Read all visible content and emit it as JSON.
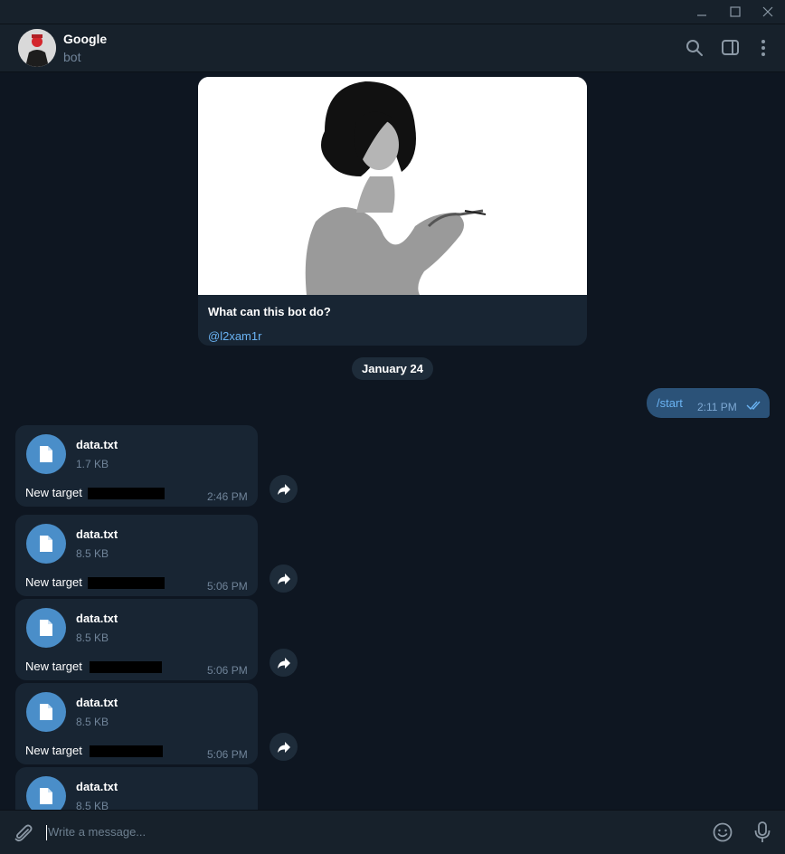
{
  "window": {
    "controls": [
      "minimize-icon",
      "maximize-icon",
      "close-icon"
    ]
  },
  "header": {
    "title": "Google",
    "subtitle": "bot",
    "actions": [
      "search-icon",
      "sidebar-toggle-icon",
      "more-vertical-icon"
    ]
  },
  "bot_intro": {
    "question": "What can this bot do?",
    "handle": "@l2xam1r"
  },
  "date_separator": "January 24",
  "outgoing": [
    {
      "text": "/start",
      "time": "2:11 PM",
      "status": "read"
    }
  ],
  "files": [
    {
      "name": "data.txt",
      "size": "1.7 KB",
      "caption": "New target",
      "time": "2:46 PM"
    },
    {
      "name": "data.txt",
      "size": "8.5 KB",
      "caption": "New target",
      "time": "5:06 PM"
    },
    {
      "name": "data.txt",
      "size": "8.5 KB",
      "caption": "New target",
      "time": "5:06 PM"
    },
    {
      "name": "data.txt",
      "size": "8.5 KB",
      "caption": "New target",
      "time": "5:06 PM"
    },
    {
      "name": "data.txt",
      "size": "8.5 KB"
    }
  ],
  "composer": {
    "placeholder": "Write a message...",
    "icons": [
      "attach-icon",
      "emoji-icon",
      "microphone-icon"
    ]
  },
  "colors": {
    "accent": "#6ab3f3",
    "bubble_out": "#2b5278",
    "bubble_in": "#182533",
    "background": "#0e1621"
  }
}
